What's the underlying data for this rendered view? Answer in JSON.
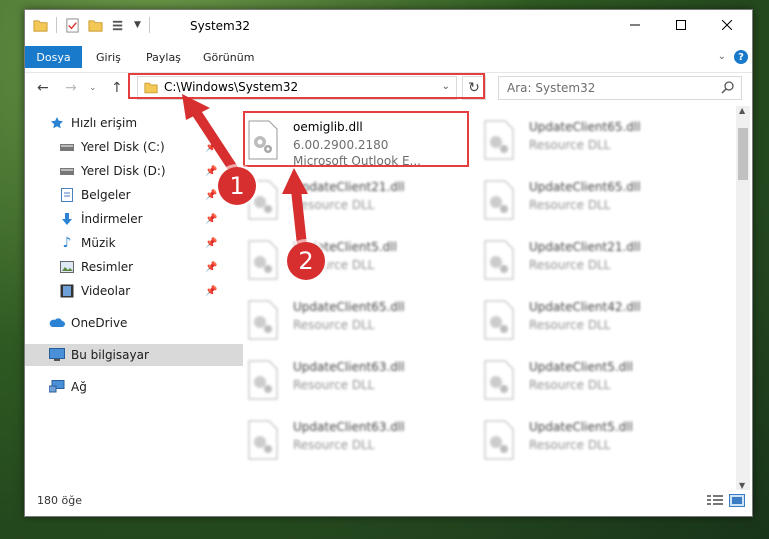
{
  "window": {
    "title": "System32"
  },
  "ribbon": {
    "tabs": [
      "Dosya",
      "Giriş",
      "Paylaş",
      "Görünüm"
    ],
    "help": "?"
  },
  "navbar": {
    "address": "C:\\Windows\\System32",
    "search_placeholder": "Ara: System32"
  },
  "sidebar": {
    "items": [
      {
        "label": "Hızlı erişim",
        "icon": "star-icon"
      },
      {
        "label": "Yerel Disk (C:)",
        "icon": "drive-icon",
        "pinned": true
      },
      {
        "label": "Yerel Disk (D:)",
        "icon": "drive-icon",
        "pinned": true
      },
      {
        "label": "Belgeler",
        "icon": "documents-icon",
        "pinned": true
      },
      {
        "label": "İndirmeler",
        "icon": "download-icon",
        "pinned": true
      },
      {
        "label": "Müzik",
        "icon": "music-icon",
        "pinned": true
      },
      {
        "label": "Resimler",
        "icon": "pictures-icon",
        "pinned": true
      },
      {
        "label": "Videolar",
        "icon": "video-icon",
        "pinned": true
      },
      {
        "label": "OneDrive",
        "icon": "cloud-icon"
      },
      {
        "label": "Bu bilgisayar",
        "icon": "computer-icon",
        "selected": true
      },
      {
        "label": "Ağ",
        "icon": "network-icon"
      }
    ]
  },
  "files": {
    "highlighted": {
      "name": "oemiglib.dll",
      "version": "6.00.2900.2180",
      "description": "Microsoft Outlook E..."
    },
    "blurred": [
      {
        "name": "UpdateClient65.dll",
        "desc": "Resource DLL"
      },
      {
        "name": "UpdateClient21.dll",
        "desc": "Resource DLL"
      },
      {
        "name": "UpdateClient65.dll",
        "desc": "Resource DLL"
      },
      {
        "name": "UpdateClient5.dll",
        "desc": "Resource DLL"
      },
      {
        "name": "UpdateClient21.dll",
        "desc": "Resource DLL"
      },
      {
        "name": "UpdateClient65.dll",
        "desc": "Resource DLL"
      },
      {
        "name": "UpdateClient42.dll",
        "desc": "Resource DLL"
      },
      {
        "name": "UpdateClient63.dll",
        "desc": "Resource DLL"
      },
      {
        "name": "UpdateClient5.dll",
        "desc": "Resource DLL"
      },
      {
        "name": "UpdateClient63.dll",
        "desc": "Resource DLL"
      },
      {
        "name": "UpdateClient5.dll",
        "desc": "Resource DLL"
      }
    ]
  },
  "status": {
    "count": "180 öğe"
  },
  "annotations": {
    "step1": "1",
    "step2": "2"
  },
  "colors": {
    "accent": "#1979ca",
    "highlight": "#e53e3e",
    "badge": "#d72f2f"
  }
}
